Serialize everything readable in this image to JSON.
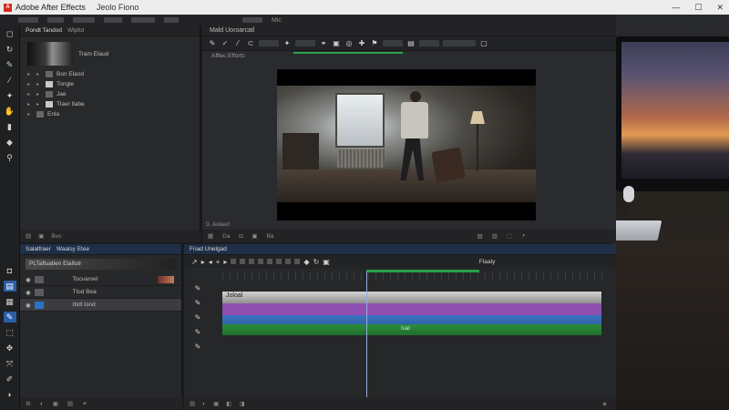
{
  "window": {
    "app_title": "Adobe After Effects",
    "doc_title": "Jeolo Fiono",
    "minimize_glyph": "—",
    "maximize_glyph": "☐",
    "close_glyph": "✕"
  },
  "menubar": {
    "label": "Mic"
  },
  "project": {
    "tabs": [
      "Pondt Tandod",
      "Wlpfol"
    ],
    "thumb_label": "Tram Elaud",
    "items": [
      {
        "label": "Bon Elaod"
      },
      {
        "label": "Tongle"
      },
      {
        "label": "Jae"
      },
      {
        "label": "Tlaer Ilabe"
      },
      {
        "label": "Enla"
      }
    ],
    "footer": {
      "left": "Bvo"
    }
  },
  "viewer": {
    "title": "Mald Uoroarcatl",
    "sub_label": "Afflec Efforts",
    "footer_left": "D Jedaed",
    "footer_items": [
      "Da",
      "Ba"
    ]
  },
  "layers": {
    "tabs": [
      "Salalfraer",
      "Waalsy Etee"
    ],
    "thumb_label": "PLTafluatlen Elalfutr",
    "rows": [
      {
        "label": "Tocvarvel"
      },
      {
        "label": "Tlod Bea"
      },
      {
        "label": "Ibdl Iond"
      }
    ]
  },
  "timeline": {
    "tab": "Fnad Unelgad",
    "track_labels": [
      "Joloal",
      "Iual"
    ],
    "right_label": "Flaaty"
  }
}
